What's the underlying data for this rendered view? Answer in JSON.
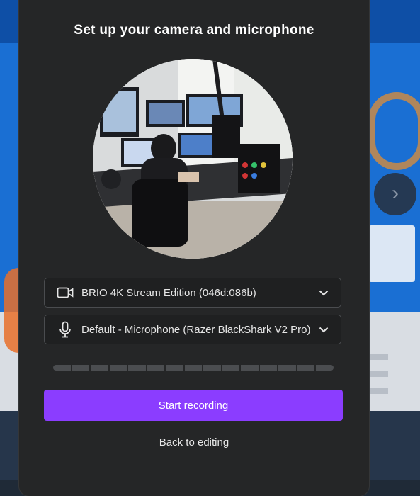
{
  "dialog": {
    "title": "Set up your camera and microphone",
    "camera": {
      "icon": "video-camera-icon",
      "selected": "BRIO 4K Stream Edition (046d:086b)"
    },
    "microphone": {
      "icon": "microphone-icon",
      "selected": "Default - Microphone (Razer BlackShark V2 Pro)"
    },
    "level_meter": {
      "segments": 15,
      "level": 0
    },
    "start_label": "Start recording",
    "back_label": "Back to editing"
  },
  "colors": {
    "accent": "#8b3dff",
    "dialog_bg": "#252627",
    "field_border": "#4a4c4f",
    "meter_off": "#4b4d50"
  }
}
